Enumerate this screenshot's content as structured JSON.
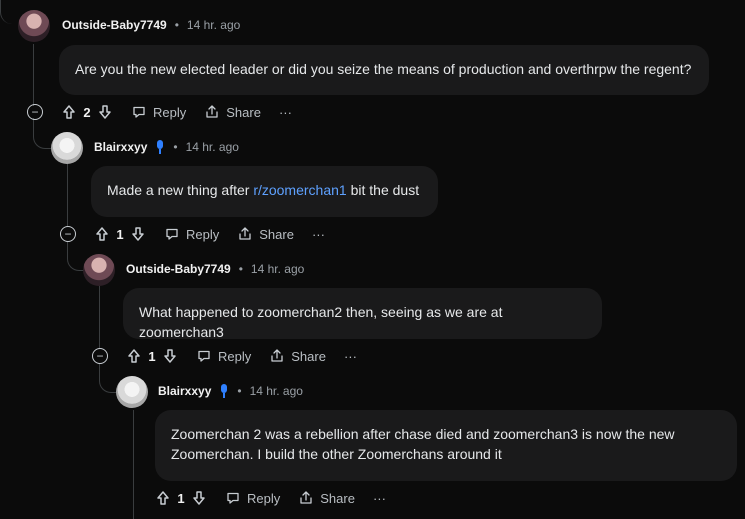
{
  "comments": [
    {
      "author": "Outside-Baby7749",
      "time": "14 hr. ago",
      "body": "Are you the new elected leader or did you seize the means of production and overthrpw the regent?",
      "votes": "2"
    },
    {
      "author": "Blairxxyy",
      "time": "14 hr. ago",
      "body_prefix": "Made a new thing after ",
      "body_link": "r/zoomerchan1",
      "body_suffix": " bit the dust",
      "votes": "1"
    },
    {
      "author": "Outside-Baby7749",
      "time": "14 hr. ago",
      "body": "What happened to zoomerchan2 then, seeing as we are at zoomerchan3",
      "votes": "1"
    },
    {
      "author": "Blairxxyy",
      "time": "14 hr. ago",
      "body": "Zoomerchan 2 was a rebellion after chase died and zoomerchan3 is now the new Zoomerchan. I build the other Zoomerchans around it",
      "votes": "1"
    }
  ],
  "labels": {
    "dot": "•",
    "reply": "Reply",
    "share": "Share",
    "more": "···",
    "collapse": "−"
  },
  "icons": {
    "upvote": "upvote-icon",
    "downvote": "downvote-icon",
    "reply": "reply-icon",
    "share": "share-icon",
    "verified": "microphone-icon"
  }
}
